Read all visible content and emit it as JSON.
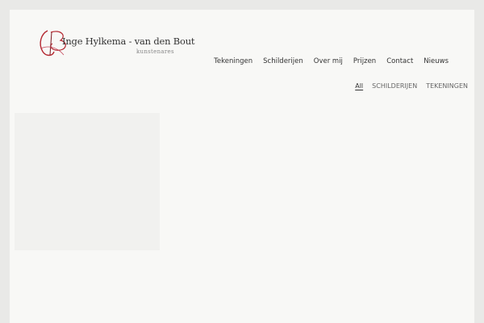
{
  "brand": {
    "name": "Inge Hylkema - van den Bout",
    "subtitle": "kunstenares",
    "accent": "#b3262f"
  },
  "nav": {
    "items": [
      "Tekeningen",
      "Schilderijen",
      "Over mij",
      "Prijzen",
      "Contact",
      "Nieuws"
    ]
  },
  "filters": {
    "items": [
      "All",
      "SCHILDERIJEN",
      "TEKENINGEN"
    ],
    "active": "All"
  }
}
